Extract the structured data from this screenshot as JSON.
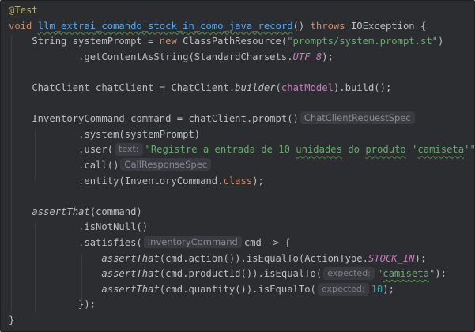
{
  "code": {
    "lines": [
      [
        {
          "t": "@Test",
          "c": "an"
        }
      ],
      [
        {
          "t": "void ",
          "c": "k"
        },
        {
          "t": "llm_extrai_comando_stock_in_como_java_record",
          "c": "fn sq"
        },
        {
          "t": "() "
        },
        {
          "t": "throws ",
          "c": "k"
        },
        {
          "t": "IOException {"
        }
      ],
      [
        {
          "t": "    String systemPrompt = "
        },
        {
          "t": "new ",
          "c": "k"
        },
        {
          "t": "ClassPathResource("
        },
        {
          "t": "\"prompts/system.prompt.st\"",
          "c": "st"
        },
        {
          "t": ")"
        }
      ],
      [
        {
          "t": "            .getContentAsString(StandardCharsets."
        },
        {
          "t": "UTF_8",
          "c": "c"
        },
        {
          "t": ");"
        }
      ],
      [],
      [
        {
          "t": "    ChatClient chatClient = ChatClient."
        },
        {
          "t": "builder",
          "c": "it"
        },
        {
          "t": "("
        },
        {
          "t": "chatModel",
          "c": "f"
        },
        {
          "t": ").build();"
        }
      ],
      [],
      [
        {
          "t": "    InventoryCommand command = chatClient.prompt()"
        },
        {
          "hint": "ChatClientRequestSpec"
        }
      ],
      [
        {
          "t": "            .system(systemPrompt)"
        }
      ],
      [
        {
          "t": "            .user("
        },
        {
          "hint": "text:",
          "pn": true
        },
        {
          "t": "\"Registre a entrada de 10 ",
          "c": "st"
        },
        {
          "t": "unidades",
          "c": "st sq"
        },
        {
          "t": " do ",
          "c": "st"
        },
        {
          "t": "produto",
          "c": "st sq"
        },
        {
          "t": " '",
          "c": "st"
        },
        {
          "t": "camiseta",
          "c": "st sq"
        },
        {
          "t": "'\"",
          "c": "st"
        },
        {
          "t": ")"
        }
      ],
      [
        {
          "t": "            .call()"
        },
        {
          "hint": "CallResponseSpec"
        }
      ],
      [
        {
          "t": "            .entity(InventoryCommand."
        },
        {
          "t": "class",
          "c": "k"
        },
        {
          "t": ");"
        }
      ],
      [],
      [
        {
          "t": "    "
        },
        {
          "t": "assertThat",
          "c": "it"
        },
        {
          "t": "(command)"
        }
      ],
      [
        {
          "t": "            .isNotNull()"
        }
      ],
      [
        {
          "t": "            .satisfies("
        },
        {
          "hint": "InventoryCommand"
        },
        {
          "t": "cmd -> {"
        }
      ],
      [
        {
          "t": "                "
        },
        {
          "t": "assertThat",
          "c": "it"
        },
        {
          "t": "(cmd.action()).isEqualTo(ActionType."
        },
        {
          "t": "STOCK_IN",
          "c": "c"
        },
        {
          "t": ");"
        }
      ],
      [
        {
          "t": "                "
        },
        {
          "t": "assertThat",
          "c": "it"
        },
        {
          "t": "(cmd.productId()).isEqualTo("
        },
        {
          "hint": "expected:",
          "pn": true
        },
        {
          "t": "\"",
          "c": "st"
        },
        {
          "t": "camiseta",
          "c": "st sq"
        },
        {
          "t": "\"",
          "c": "st"
        },
        {
          "t": ");"
        }
      ],
      [
        {
          "t": "                "
        },
        {
          "t": "assertThat",
          "c": "it"
        },
        {
          "t": "(cmd.quantity()).isEqualTo("
        },
        {
          "hint": "expected:",
          "pn": true
        },
        {
          "t": "10",
          "c": "nm"
        },
        {
          "t": ");"
        }
      ],
      [
        {
          "t": "            });"
        }
      ],
      [
        {
          "t": "}"
        }
      ]
    ]
  }
}
